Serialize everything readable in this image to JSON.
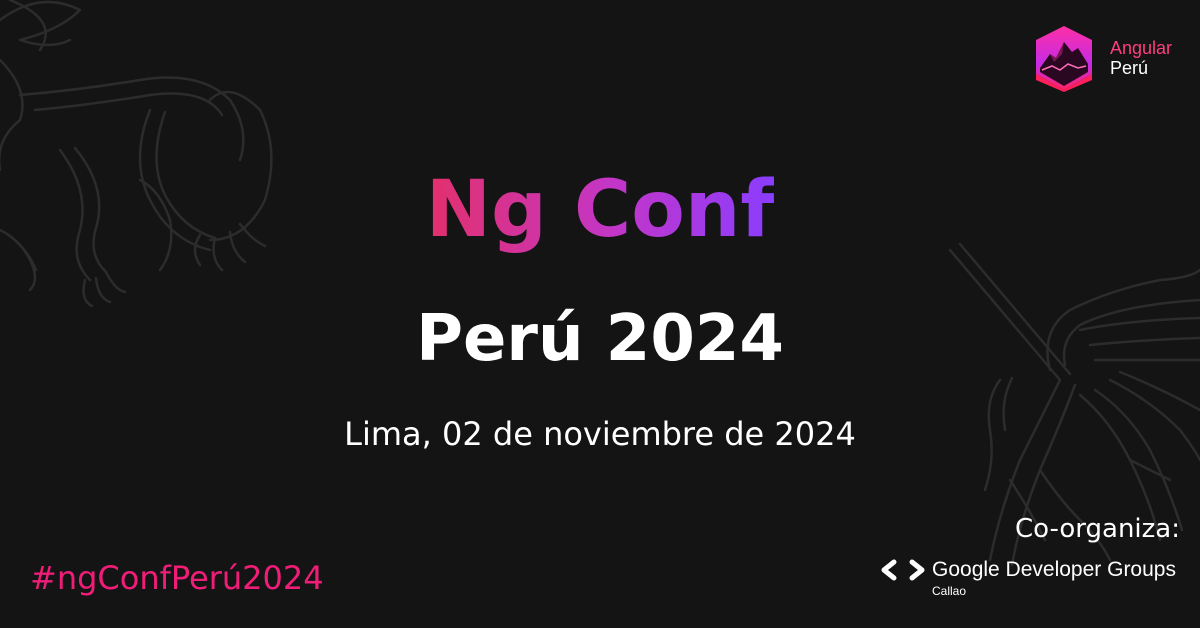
{
  "event": {
    "title": "Ng Conf",
    "subtitle": "Perú 2024",
    "date": "Lima, 02 de noviembre de 2024",
    "hashtag": "#ngConfPerú2024"
  },
  "logo": {
    "name_line1": "Angular",
    "name_line2": "Perú",
    "icon": "angular-peru-shield-icon"
  },
  "coorganizer": {
    "label": "Co-organiza:",
    "name": "Google Developer Groups",
    "city": "Callao",
    "icon": "gdg-brackets-icon"
  },
  "colors": {
    "background": "#141414",
    "hashtag": "#f01d78",
    "gradient_start": "#e3306c",
    "gradient_end": "#8a3dff"
  }
}
